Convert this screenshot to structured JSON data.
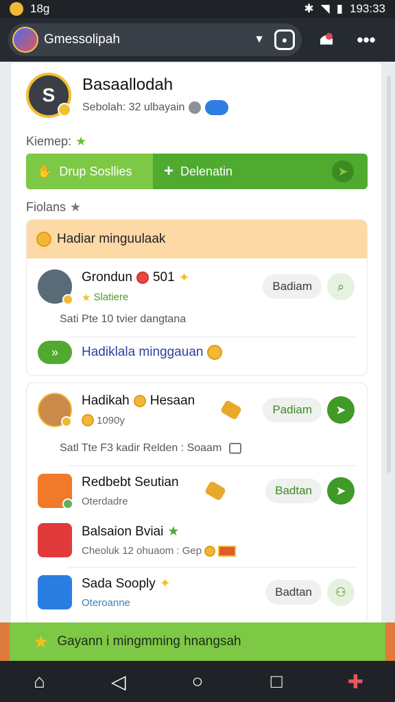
{
  "status": {
    "left_text": "18g",
    "time": "193:33"
  },
  "appbar": {
    "title": "Gmessolipah"
  },
  "profile": {
    "name": "Basaallodah",
    "subtitle": "Sebolah: 32 ulbayain"
  },
  "section1": {
    "label": "Kiemep:"
  },
  "greenbar": {
    "left_label": "Drup Sosllies",
    "right_label": "Delenatin"
  },
  "section2": {
    "label": "Fiolans"
  },
  "card1": {
    "header": "Hadiar minguulaak",
    "row": {
      "title": "Grondun",
      "score": "501",
      "sub": "Slatiere",
      "button": "Badiam"
    },
    "desc": "Sati Pte 10 tvier dangtana",
    "link": "Hadiklala minggauan"
  },
  "card2": {
    "rows": [
      {
        "title": "Hadikah",
        "title2": "Hesaan",
        "sub": "1090y",
        "button": "Padiam"
      },
      {
        "title": "Redbebt Seutian",
        "sub": "Oterdadre",
        "button": "Badtan"
      },
      {
        "title": "Balsaion Bviai",
        "sub": "Cheoluk 12 ohuaom : Gep"
      },
      {
        "title": "Sada Sooply",
        "sub": "Oteroanne",
        "button": "Badtan"
      }
    ],
    "desc": "Satl Tte F3 kadir Relden : Soaam"
  },
  "banner": {
    "text": "Gayann i mingmming hnangsah"
  },
  "colors": {
    "accent_green": "#4faa2f",
    "light_green": "#7dc844",
    "header_orange": "#fdd9a6",
    "dark": "#1f2328"
  }
}
